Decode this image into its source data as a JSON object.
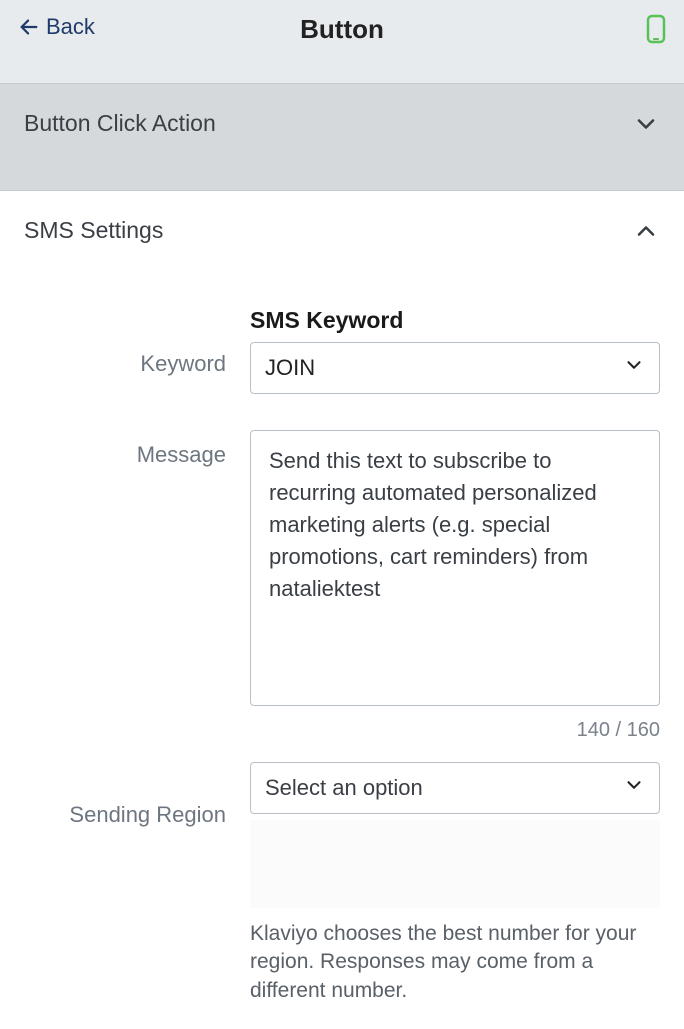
{
  "header": {
    "back_label": "Back",
    "title": "Button"
  },
  "sections": {
    "click_action": {
      "title": "Button Click Action"
    },
    "sms_settings": {
      "title": "SMS Settings",
      "keyword": {
        "label": "Keyword",
        "heading": "SMS Keyword",
        "value": "JOIN"
      },
      "message": {
        "label": "Message",
        "value": "Send this text to subscribe to recurring automated personalized marketing alerts (e.g. special promotions, cart reminders) from nataliektest",
        "char_count": "140 / 160"
      },
      "region": {
        "label": "Sending Region",
        "placeholder": "Select an option",
        "helper": "Klaviyo chooses the best number for your region. Responses may come from a different number."
      }
    }
  }
}
